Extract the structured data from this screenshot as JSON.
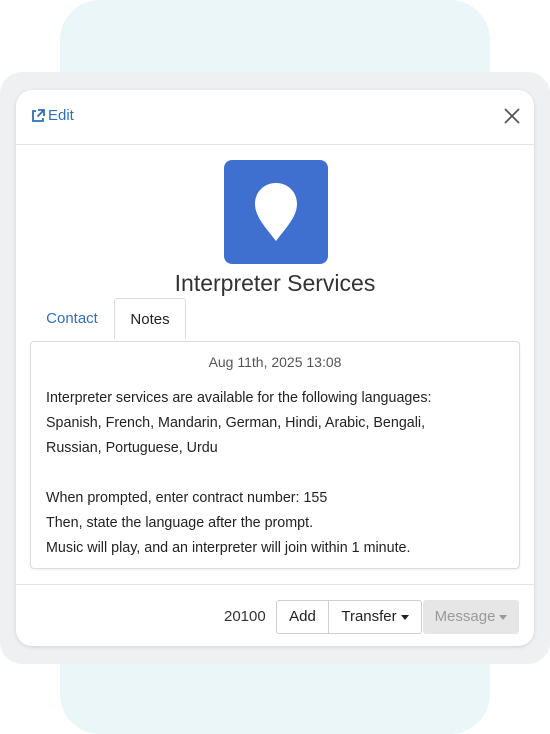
{
  "header": {
    "edit_label": "Edit"
  },
  "contact": {
    "name": "Interpreter Services",
    "avatar_color": "#3f6fcf",
    "avatar_icon": "map-pin-icon"
  },
  "tabs": [
    {
      "label": "Contact",
      "active": false
    },
    {
      "label": "Notes",
      "active": true
    }
  ],
  "note": {
    "timestamp": "Aug 11th, 2025 13:08",
    "lines": [
      "Interpreter services are available for the following languages:",
      "Spanish, French, Mandarin, German, Hindi, Arabic, Bengali,",
      "Russian, Portuguese, Urdu",
      "",
      "When prompted, enter contract number: 155",
      "Then, state the language after the prompt.",
      "Music will play, and an interpreter will join within 1 minute."
    ]
  },
  "footer": {
    "extension": "20100",
    "add_label": "Add",
    "transfer_label": "Transfer",
    "message_label": "Message"
  },
  "colors": {
    "link": "#2f6fb6",
    "background_panel": "#eaf6f8"
  }
}
